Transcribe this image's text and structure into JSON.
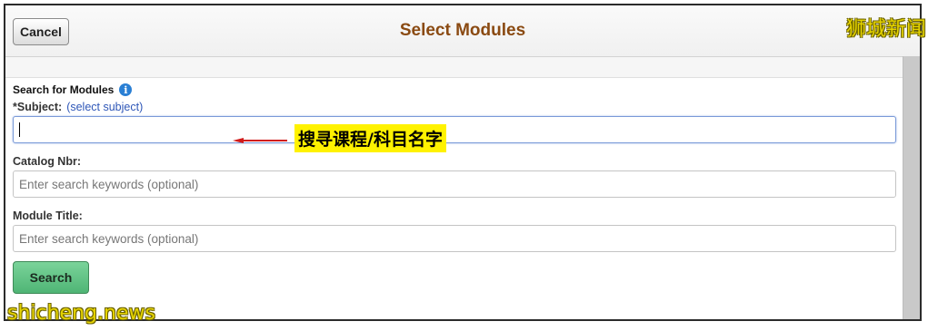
{
  "header": {
    "cancel_label": "Cancel",
    "title": "Select Modules",
    "watermark": "狮城新闻"
  },
  "search": {
    "section_title": "Search for Modules",
    "info_icon": "info-icon",
    "subject_label": "*Subject:",
    "subject_link": "(select subject)",
    "subject_value": "",
    "catalog_label": "Catalog Nbr:",
    "catalog_placeholder": "Enter search keywords (optional)",
    "title_label": "Module Title:",
    "title_placeholder": "Enter search keywords (optional)",
    "search_label": "Search"
  },
  "annotation": {
    "label": "搜寻课程/科目名字",
    "arrow_color": "#d11a1a",
    "highlight_color": "#fff200"
  },
  "footer": {
    "watermark": "shicheng.news"
  },
  "colors": {
    "title": "#8a4a12",
    "link": "#2f57b8",
    "search_button": "#4fb575"
  }
}
